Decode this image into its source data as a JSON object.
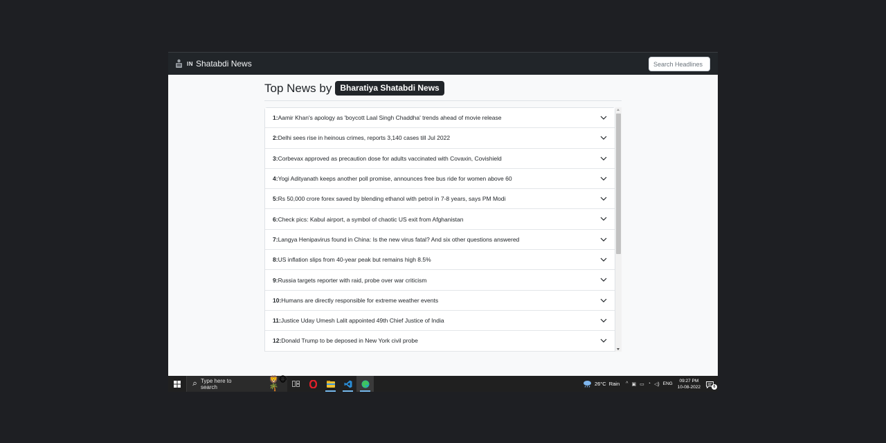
{
  "navbar": {
    "brand_flag": "IN",
    "brand_name": "Shatabdi News",
    "search_placeholder": "Search Headlines"
  },
  "heading": {
    "prefix": "Top News by",
    "badge": "Bharatiya Shatabdi News"
  },
  "news": [
    {
      "num": "1:",
      "headline": "Aamir Khan's apology as 'boycott Laal Singh Chaddha' trends ahead of movie release"
    },
    {
      "num": "2:",
      "headline": "Delhi sees rise in heinous crimes, reports 3,140 cases till Jul 2022"
    },
    {
      "num": "3:",
      "headline": "Corbevax approved as precaution dose for adults vaccinated with Covaxin, Covishield"
    },
    {
      "num": "4:",
      "headline": "Yogi Adityanath keeps another poll promise, announces free bus ride for women above 60"
    },
    {
      "num": "5:",
      "headline": "Rs 50,000 crore forex saved by blending ethanol with petrol in 7-8 years, says PM Modi"
    },
    {
      "num": "6:",
      "headline": "Check pics: Kabul airport, a symbol of chaotic US exit from Afghanistan"
    },
    {
      "num": "7:",
      "headline": "Langya Henipavirus found in China: Is the new virus fatal? And six other questions answered"
    },
    {
      "num": "8:",
      "headline": "US inflation slips from 40-year peak but remains high 8.5%"
    },
    {
      "num": "9:",
      "headline": "Russia targets reporter with raid, probe over war criticism"
    },
    {
      "num": "10:",
      "headline": "Humans are directly responsible for extreme weather events"
    },
    {
      "num": "11:",
      "headline": "Justice Uday Umesh Lalit appointed 49th Chief Justice of India"
    },
    {
      "num": "12:",
      "headline": "Donald Trump to be deposed in New York civil probe"
    }
  ],
  "taskbar": {
    "search_placeholder": "Type here to search",
    "weather_temp": "26°C",
    "weather_condition": "Rain",
    "language": "ENG",
    "time": "09:27 PM",
    "date": "10-08-2022",
    "notification_count": "6",
    "pinned_icons": [
      "windows-start-icon",
      "task-view-icon",
      "opera-icon",
      "file-explorer-icon",
      "vscode-icon",
      "edge-icon"
    ]
  },
  "colors": {
    "navbar_bg": "#212529",
    "badge_bg": "#212529",
    "page_bg": "#f8f9fa",
    "taskbar_bg": "#202020",
    "accent": "#76b9ed"
  }
}
